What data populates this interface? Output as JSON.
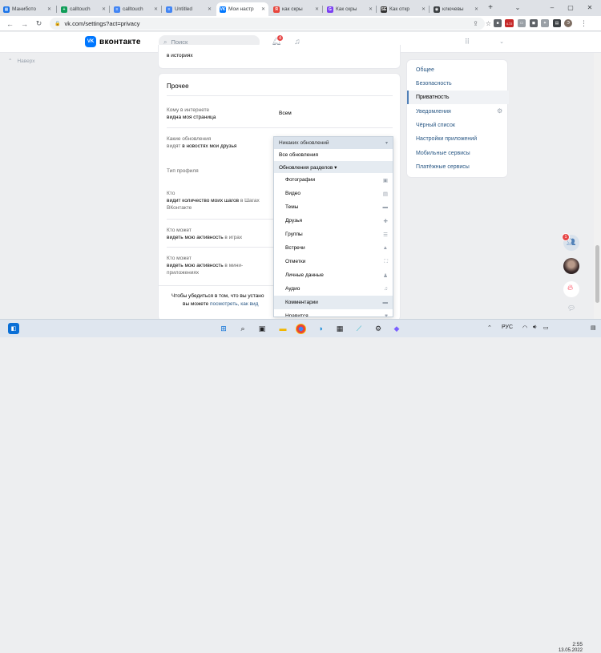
{
  "browser": {
    "tabs": [
      {
        "label": "Манибото",
        "color": "#1a73e8",
        "glyph": "▦"
      },
      {
        "label": "calltouch",
        "color": "#0f9d58",
        "glyph": "+"
      },
      {
        "label": "calltouch",
        "color": "#4285f4",
        "glyph": "≡"
      },
      {
        "label": "Untitled",
        "color": "#4285f4",
        "glyph": "≡"
      },
      {
        "label": "Мои настр",
        "color": "#0077ff",
        "glyph": "VK",
        "active": true
      },
      {
        "label": "как скры",
        "color": "#e8453c",
        "glyph": "Я"
      },
      {
        "label": "Как скры",
        "color": "#7b3ff2",
        "glyph": "G"
      },
      {
        "label": "Как откр",
        "color": "#333333",
        "glyph": "SE"
      },
      {
        "label": "ключевы",
        "color": "#3c4043",
        "glyph": "◉"
      }
    ],
    "new_tab": "+",
    "url": "vk.com/settings?act=privacy",
    "ext_badge": "4.72"
  },
  "header": {
    "logo_mark": "VK",
    "logo_text": "вконтакте",
    "search_placeholder": "Поиск",
    "notif_count": "4"
  },
  "nav": {
    "back_label": "Наверх"
  },
  "main": {
    "top_text": "в историях",
    "section_title": "Прочее",
    "rows": [
      {
        "label_plain": "Кому в интернете",
        "label_bold": "видна моя страница",
        "value": "Всем"
      },
      {
        "label_plain": "Какие обновления",
        "label_bold_prefix": "видят ",
        "label_bold": "в новостях мои друзья",
        "value": "Никаких обновлений"
      },
      {
        "label_plain": "Тип профиля",
        "label_bold": "",
        "value": ""
      },
      {
        "label_plain": "Кто",
        "label_bold": "видит количество моих шагов",
        "label_tail": " в Шагах ВКонтакте",
        "value": ""
      },
      {
        "label_plain": "Кто может",
        "label_bold": "видеть мою активность",
        "label_tail": " в играх",
        "value": ""
      },
      {
        "label_plain": "Кто может",
        "label_bold": "видеть мою активность",
        "label_tail": " в мини-приложениях",
        "value": ""
      }
    ],
    "footer_line1": "Чтобы убедиться в том, что вы устано",
    "footer_line2_plain": "вы можете ",
    "footer_line2_link": "посмотреть, как вид"
  },
  "dropdown": {
    "selected": "Никаких обновлений",
    "items": [
      {
        "label": "Все обновления",
        "level": "top",
        "icon": ""
      },
      {
        "label": "Обновления разделов ▾",
        "level": "top",
        "icon": "",
        "highlight": true
      },
      {
        "label": "Фотографии",
        "level": "sub",
        "icon": "▣"
      },
      {
        "label": "Видео",
        "level": "sub",
        "icon": "▤"
      },
      {
        "label": "Темы",
        "level": "sub",
        "icon": "▬"
      },
      {
        "label": "Друзья",
        "level": "sub",
        "icon": "✚"
      },
      {
        "label": "Группы",
        "level": "sub",
        "icon": "☰"
      },
      {
        "label": "Встречи",
        "level": "sub",
        "icon": "▲"
      },
      {
        "label": "Отметки",
        "level": "sub",
        "icon": "⛶"
      },
      {
        "label": "Личные данные",
        "level": "sub",
        "icon": "♟"
      },
      {
        "label": "Аудио",
        "level": "sub",
        "icon": "♫"
      },
      {
        "label": "Комментарии",
        "level": "sub",
        "icon": "▬",
        "highlight": true
      },
      {
        "label": "Нравится",
        "level": "sub",
        "icon": "♥"
      }
    ]
  },
  "right_menu": {
    "items": [
      {
        "label": "Общее"
      },
      {
        "label": "Безопасность"
      },
      {
        "label": "Приватность",
        "active": true
      },
      {
        "label": "Уведомления"
      },
      {
        "label": "Чёрный список"
      },
      {
        "label": "Настройки приложений"
      },
      {
        "label": "Мобильные сервисы"
      },
      {
        "label": "Платёжные сервисы"
      }
    ]
  },
  "side": {
    "chat_badge": "1"
  },
  "taskbar": {
    "lang": "РУС",
    "time": "2:55",
    "date": "13.05.2022"
  }
}
